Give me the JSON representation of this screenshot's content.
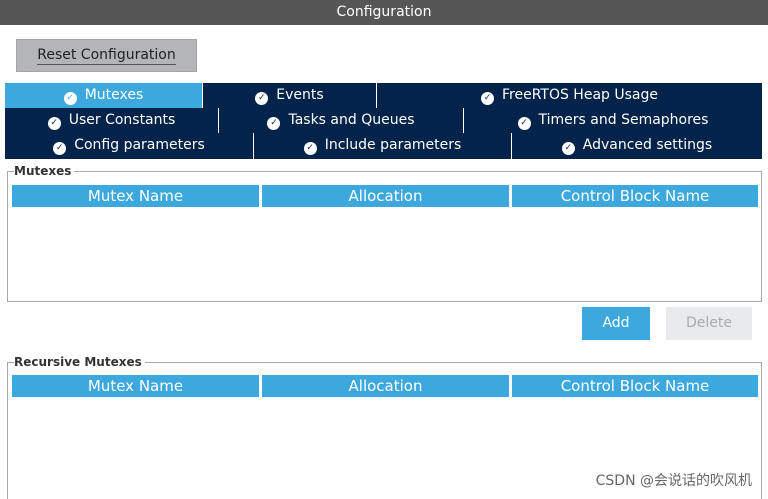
{
  "window": {
    "title": "Configuration"
  },
  "toolbar": {
    "reset_label": "Reset Configuration"
  },
  "tabs": {
    "row1": [
      "Mutexes",
      "Events",
      "FreeRTOS Heap Usage"
    ],
    "row2": [
      "User Constants",
      "Tasks and Queues",
      "Timers and Semaphores"
    ],
    "row3": [
      "Config parameters",
      "Include parameters",
      "Advanced settings"
    ],
    "active": "Mutexes"
  },
  "mutexes": {
    "group_label": "Mutexes",
    "columns": [
      "Mutex Name",
      "Allocation",
      "Control Block Name"
    ],
    "add_label": "Add",
    "delete_label": "Delete"
  },
  "recursive_mutexes": {
    "group_label": "Recursive Mutexes",
    "columns": [
      "Mutex Name",
      "Allocation",
      "Control Block Name"
    ]
  },
  "watermark": "CSDN @会说话的吹风机",
  "colors": {
    "accent": "#3ca8dd",
    "navy": "#03234b",
    "titlebar": "#565656"
  }
}
